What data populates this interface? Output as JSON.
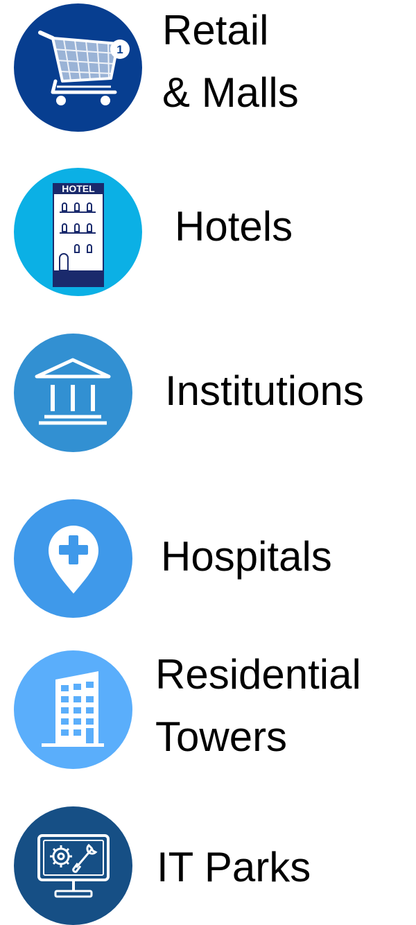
{
  "colors": {
    "retail": "#073e90",
    "hotels": "#0bb0e5",
    "institutions": "#3290d2",
    "hospitals": "#3f99ea",
    "residential": "#5aaefb",
    "it_parks": "#164f85"
  },
  "sectors": [
    {
      "line1": "Retail",
      "line2": "& Malls",
      "icon": "shopping-cart-icon"
    },
    {
      "line1": "Hotels",
      "icon": "hotel-building-icon",
      "sign": "HOTEL"
    },
    {
      "line1": "Institutions",
      "icon": "institution-building-icon"
    },
    {
      "line1": "Hospitals",
      "icon": "hospital-location-pin-icon"
    },
    {
      "line1": "Residential",
      "line2": "Towers",
      "icon": "residential-tower-icon"
    },
    {
      "line1": "IT Parks",
      "icon": "computer-settings-icon"
    }
  ],
  "cart_badge": "1"
}
